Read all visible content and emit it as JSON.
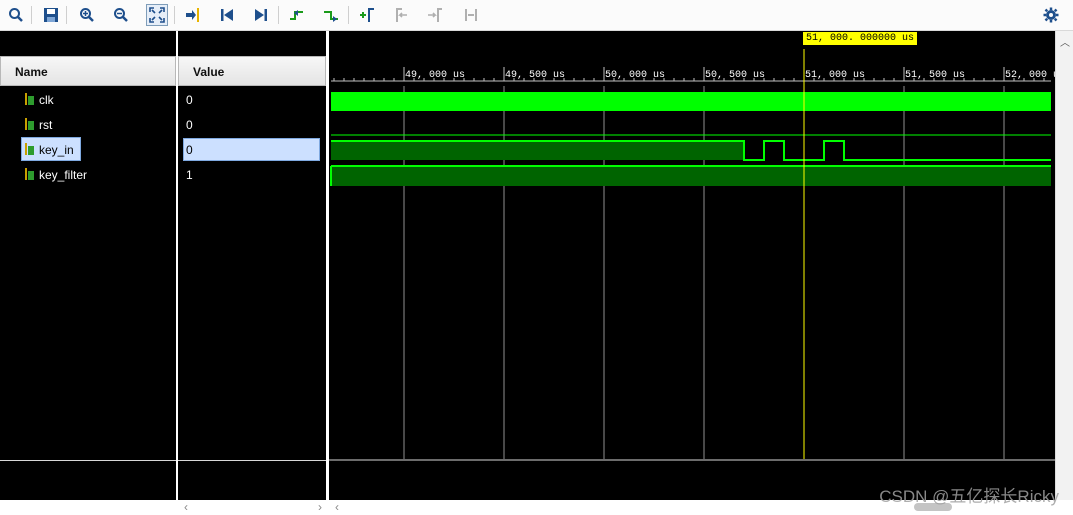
{
  "toolbar": {
    "buttons": [
      {
        "name": "search-icon"
      },
      {
        "name": "save-icon"
      },
      {
        "name": "zoom-in-icon"
      },
      {
        "name": "zoom-out-icon"
      },
      {
        "name": "zoom-fit-icon"
      },
      {
        "name": "go-to-cursor-icon"
      },
      {
        "name": "go-to-start-icon"
      },
      {
        "name": "go-to-end-icon"
      },
      {
        "name": "previous-transition-icon"
      },
      {
        "name": "next-transition-icon"
      },
      {
        "name": "add-marker-icon"
      },
      {
        "name": "previous-marker-icon"
      },
      {
        "name": "next-marker-icon"
      },
      {
        "name": "swap-cursors-icon"
      },
      {
        "name": "settings-gear-icon"
      }
    ]
  },
  "columns": {
    "name_header": "Name",
    "value_header": "Value"
  },
  "signals": [
    {
      "name": "clk",
      "value": "0"
    },
    {
      "name": "rst",
      "value": "0"
    },
    {
      "name": "key_in",
      "value": "0",
      "selected": true
    },
    {
      "name": "key_filter",
      "value": "1"
    }
  ],
  "timeline": {
    "ticks": [
      "49, 000 us",
      "49, 500 us",
      "50, 000 us",
      "50, 500 us",
      "51, 000 us",
      "51, 500 us",
      "52, 000 u"
    ],
    "cursor_label": "51, 000. 000000 us"
  },
  "watermark": "CSDN @五亿探长Ricky",
  "colors": {
    "wave": "#00ff00",
    "cursor": "#ffff00",
    "selection": "#cce0ff"
  }
}
